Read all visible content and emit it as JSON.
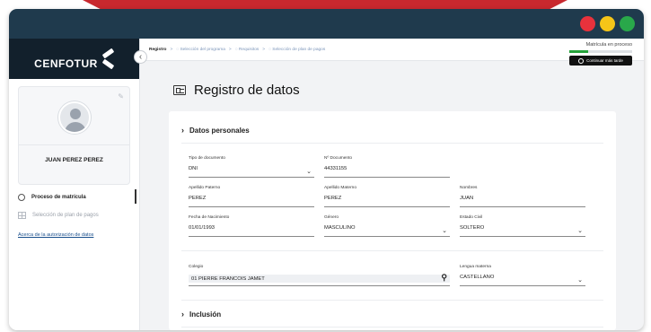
{
  "colors": {
    "ribbon": "#c8282e",
    "titlebar": "#1f3a4d",
    "dot_red": "#e8323c",
    "dot_yellow": "#f5c518",
    "dot_green": "#29a84a",
    "progress": "#25a23a",
    "link": "#1a4f8c"
  },
  "brand": {
    "name": "CENFOTUR"
  },
  "sidebar": {
    "profile_name": "JUAN PEREZ PEREZ",
    "items": [
      {
        "label": "Proceso de matrícula",
        "icon": "circle-icon",
        "active": true
      },
      {
        "label": "Selección de plan de pagos",
        "icon": "grid-icon",
        "active": false
      }
    ],
    "privacy_link": "Acerca de la autorización de datos"
  },
  "topbar": {
    "breadcrumb": [
      "Registro",
      ">",
      "Selección del programa",
      ">",
      "Requisitos",
      ">",
      "Selección de plan de pagos"
    ],
    "progress_label": "Matrícula en proceso",
    "progress_fraction": 0.3,
    "later_button": "Continuar más tarde"
  },
  "page": {
    "title": "Registro de datos"
  },
  "sections": {
    "personal": "Datos personales",
    "inclusion": "Inclusión"
  },
  "fields": {
    "doc_type": {
      "label": "Tipo de documento",
      "value": "DNI"
    },
    "doc_number": {
      "label": "Nº Documento",
      "value": "44331155"
    },
    "paternal": {
      "label": "Apellido Paterno",
      "value": "PEREZ"
    },
    "maternal": {
      "label": "Apellido Materno",
      "value": "PEREZ"
    },
    "names": {
      "label": "Nombres",
      "value": "JUAN"
    },
    "birth": {
      "label": "Fecha de Nacimiento",
      "value": "01/01/1993"
    },
    "gender": {
      "label": "Género",
      "value": "MASCULINO"
    },
    "civil": {
      "label": "Estado Civil",
      "value": "SOLTERO"
    },
    "school": {
      "label": "Colegio",
      "value": "01 PIERRE FRANCOIS JAMET"
    },
    "language": {
      "label": "Lengua materna",
      "value": "CASTELLANO"
    }
  }
}
